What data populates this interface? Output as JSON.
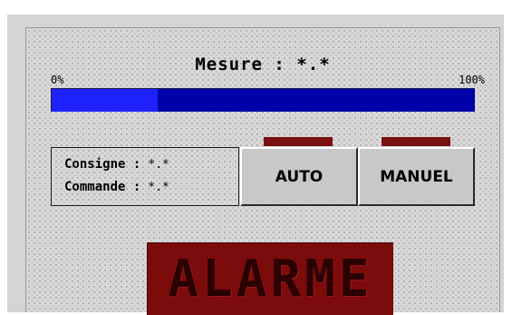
{
  "measure": {
    "title": "Mesure : *.*",
    "scale_min": "0%",
    "scale_max": "100%",
    "level_fraction": 0.25
  },
  "info": {
    "consigne_label": "Consigne :",
    "consigne_value": "*.*",
    "commande_label": "Commande :",
    "commande_value": "*.*"
  },
  "buttons": {
    "auto_label": "AUTO",
    "manuel_label": "MANUEL"
  },
  "alarm": {
    "text": "ALARME"
  },
  "colors": {
    "bar_background": "#0000a8",
    "bar_fill": "#1e22ff",
    "indicator_led": "#7a1010",
    "alarm_background": "#7c0b0b",
    "button_face": "#c8c8c8"
  }
}
